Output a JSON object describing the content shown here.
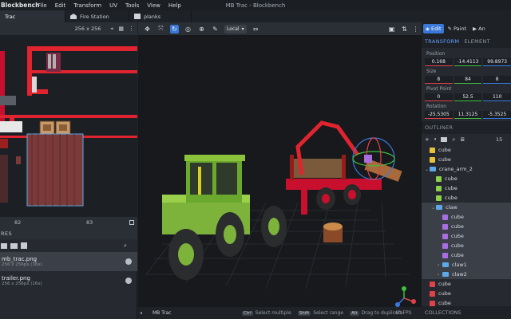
{
  "app": {
    "brand": "Blockbench",
    "window_title": "MB Trac - Blockbench",
    "menu": [
      "File",
      "Edit",
      "Transform",
      "UV",
      "Tools",
      "View",
      "Help"
    ]
  },
  "tabs": [
    {
      "label": "Trac",
      "active": true
    },
    {
      "label": "Fire Station",
      "active": false
    },
    {
      "label": "planks",
      "active": false
    }
  ],
  "uv_editor": {
    "size_select": "256 x 256",
    "ruler": [
      "82",
      "83"
    ]
  },
  "textures": {
    "header": "RES",
    "items": [
      {
        "name": "mb_trac.png",
        "info": "256 x 256px (16x)",
        "selected": true
      },
      {
        "name": "trailer.png",
        "info": "256 x 256px (16x)",
        "selected": false
      }
    ]
  },
  "viewport": {
    "space_select": "Local",
    "model_name": "MB Trac",
    "hints": [
      {
        "key": "Ctrl",
        "text": "Select multiple"
      },
      {
        "key": "Shift",
        "text": "Select range"
      },
      {
        "key": "Alt",
        "text": "Drag to duplicate"
      }
    ],
    "fps": "60 FPS"
  },
  "modes": [
    {
      "label": "Edit",
      "active": true
    },
    {
      "label": "Paint",
      "active": false
    },
    {
      "label": "An",
      "active": false
    }
  ],
  "panel_tabs": {
    "transform": "TRANSFORM",
    "element": "ELEMENT"
  },
  "transform": {
    "position_label": "Position",
    "position": [
      "0.168",
      "-14.4113",
      "99.8973"
    ],
    "size_label": "Size",
    "size": [
      "8",
      "84",
      "8"
    ],
    "pivot_label": "Pivot Point",
    "pivot": [
      "0",
      "52.5",
      "110"
    ],
    "rotation_label": "Rotation",
    "rotation": [
      "-25.5305",
      "11.3125",
      "-5.3525"
    ]
  },
  "outliner": {
    "header": "OUTLINER",
    "count": "15",
    "rows": [
      {
        "label": "cube",
        "kind": "cube",
        "color": "#e8c23a",
        "indent": 1,
        "selected": false
      },
      {
        "label": "cube",
        "kind": "cube",
        "color": "#e8c23a",
        "indent": 1,
        "selected": false
      },
      {
        "label": "crane_arm_2",
        "kind": "folder",
        "color": "#5fa8e8",
        "indent": 1,
        "selected": false,
        "caret": "v"
      },
      {
        "label": "cube",
        "kind": "cube",
        "color": "#8bd14a",
        "indent": 2,
        "selected": false
      },
      {
        "label": "cube",
        "kind": "cube",
        "color": "#8bd14a",
        "indent": 2,
        "selected": false
      },
      {
        "label": "cube",
        "kind": "cube",
        "color": "#8bd14a",
        "indent": 2,
        "selected": false
      },
      {
        "label": "claw",
        "kind": "folder",
        "color": "#5fa8e8",
        "indent": 2,
        "selected": true,
        "caret": "v"
      },
      {
        "label": "cube",
        "kind": "cube",
        "color": "#a86ee0",
        "indent": 3,
        "selected": true
      },
      {
        "label": "cube",
        "kind": "cube",
        "color": "#a86ee0",
        "indent": 3,
        "selected": true
      },
      {
        "label": "cube",
        "kind": "cube",
        "color": "#a86ee0",
        "indent": 3,
        "selected": true
      },
      {
        "label": "cube",
        "kind": "cube",
        "color": "#a86ee0",
        "indent": 3,
        "selected": true
      },
      {
        "label": "cube",
        "kind": "cube",
        "color": "#a86ee0",
        "indent": 3,
        "selected": true
      },
      {
        "label": "claw1",
        "kind": "folder",
        "color": "#5fa8e8",
        "indent": 3,
        "selected": true,
        "caret": ">"
      },
      {
        "label": "claw2",
        "kind": "folder",
        "color": "#5fa8e8",
        "indent": 3,
        "selected": true,
        "caret": ">"
      },
      {
        "label": "cube",
        "kind": "cube",
        "color": "#e0424a",
        "indent": 1,
        "selected": false
      },
      {
        "label": "cube",
        "kind": "cube",
        "color": "#e0424a",
        "indent": 1,
        "selected": false
      },
      {
        "label": "cube",
        "kind": "cube",
        "color": "#e0424a",
        "indent": 1,
        "selected": false
      }
    ]
  },
  "collections": {
    "header": "COLLECTIONS"
  },
  "colors": {
    "accent": "#3a78d8",
    "x_axis": "#e0424a",
    "y_axis": "#3fbf3f",
    "z_axis": "#3a7ae0"
  }
}
